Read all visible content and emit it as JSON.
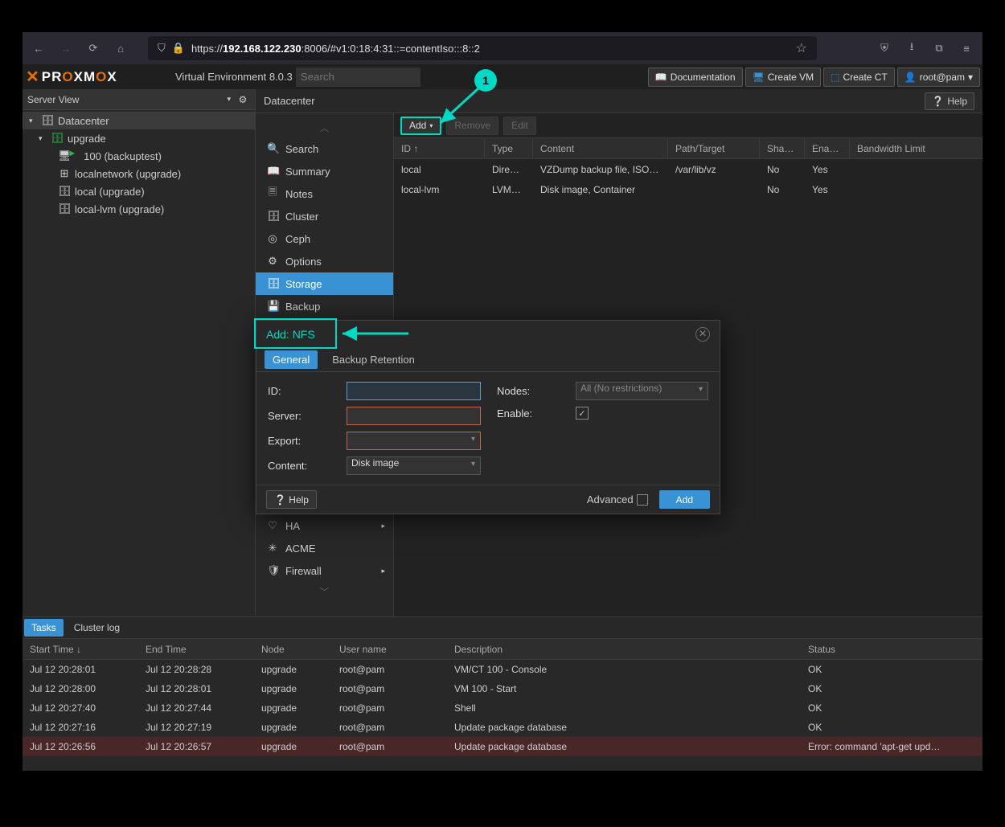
{
  "browser": {
    "url_prefix": "https://",
    "url_bold": "192.168.122.230",
    "url_rest": ":8006/#v1:0:18:4:31::=contentIso:::8::2"
  },
  "topbar": {
    "logo_pre": "PR",
    "logo_o1": "O",
    "logo_mid": "XM",
    "logo_o2": "O",
    "logo_end": "X",
    "ve": "Virtual Environment 8.0.3",
    "search_placeholder": "Search",
    "documentation": "Documentation",
    "create_vm": "Create VM",
    "create_ct": "Create CT",
    "user": "root@pam"
  },
  "leftpanel": {
    "server_view": "Server View",
    "tree": {
      "datacenter": "Datacenter",
      "upgrade": "upgrade",
      "vm100": "100 (backuptest)",
      "localnetwork": "localnetwork (upgrade)",
      "local": "local (upgrade)",
      "locallvm": "local-lvm (upgrade)"
    }
  },
  "breadcrumb": {
    "path": "Datacenter",
    "help": "Help"
  },
  "sidebar": {
    "search": "Search",
    "summary": "Summary",
    "notes": "Notes",
    "cluster": "Cluster",
    "ceph": "Ceph",
    "options": "Options",
    "storage": "Storage",
    "backup": "Backup",
    "ha": "HA",
    "acme": "ACME",
    "firewall": "Firewall"
  },
  "toolbar": {
    "add": "Add",
    "remove": "Remove",
    "edit": "Edit"
  },
  "grid": {
    "hdr": {
      "id": "ID ↑",
      "type": "Type",
      "content": "Content",
      "path": "Path/Target",
      "sha": "Sha…",
      "ena": "Ena…",
      "bw": "Bandwidth Limit"
    },
    "rows": [
      {
        "id": "local",
        "type": "Dire…",
        "content": "VZDump backup file, ISO…",
        "path": "/var/lib/vz",
        "sha": "No",
        "ena": "Yes",
        "bw": ""
      },
      {
        "id": "local-lvm",
        "type": "LVM…",
        "content": "Disk image, Container",
        "path": "",
        "sha": "No",
        "ena": "Yes",
        "bw": ""
      }
    ]
  },
  "tasks": {
    "tab_tasks": "Tasks",
    "tab_log": "Cluster log",
    "hdr": {
      "st": "Start Time ↓",
      "et": "End Time",
      "node": "Node",
      "user": "User name",
      "desc": "Description",
      "status": "Status"
    },
    "rows": [
      {
        "st": "Jul 12 20:28:01",
        "et": "Jul 12 20:28:28",
        "node": "upgrade",
        "user": "root@pam",
        "desc": "VM/CT 100 - Console",
        "status": "OK"
      },
      {
        "st": "Jul 12 20:28:00",
        "et": "Jul 12 20:28:01",
        "node": "upgrade",
        "user": "root@pam",
        "desc": "VM 100 - Start",
        "status": "OK"
      },
      {
        "st": "Jul 12 20:27:40",
        "et": "Jul 12 20:27:44",
        "node": "upgrade",
        "user": "root@pam",
        "desc": "Shell",
        "status": "OK"
      },
      {
        "st": "Jul 12 20:27:16",
        "et": "Jul 12 20:27:19",
        "node": "upgrade",
        "user": "root@pam",
        "desc": "Update package database",
        "status": "OK"
      },
      {
        "st": "Jul 12 20:26:56",
        "et": "Jul 12 20:26:57",
        "node": "upgrade",
        "user": "root@pam",
        "desc": "Update package database",
        "status": "Error: command 'apt-get upd…",
        "error": true
      }
    ]
  },
  "dialog": {
    "title": "Add: NFS",
    "tab_general": "General",
    "tab_retention": "Backup Retention",
    "labels": {
      "id": "ID:",
      "server": "Server:",
      "export": "Export:",
      "content": "Content:",
      "nodes": "Nodes:",
      "enable": "Enable:"
    },
    "content_value": "Disk image",
    "nodes_value": "All (No restrictions)",
    "help": "Help",
    "advanced": "Advanced",
    "add_btn": "Add"
  },
  "anno": {
    "num1": "1"
  },
  "colors": {
    "accent": "#00d9c5",
    "blue": "#3892d4",
    "orange": "#e57000"
  }
}
